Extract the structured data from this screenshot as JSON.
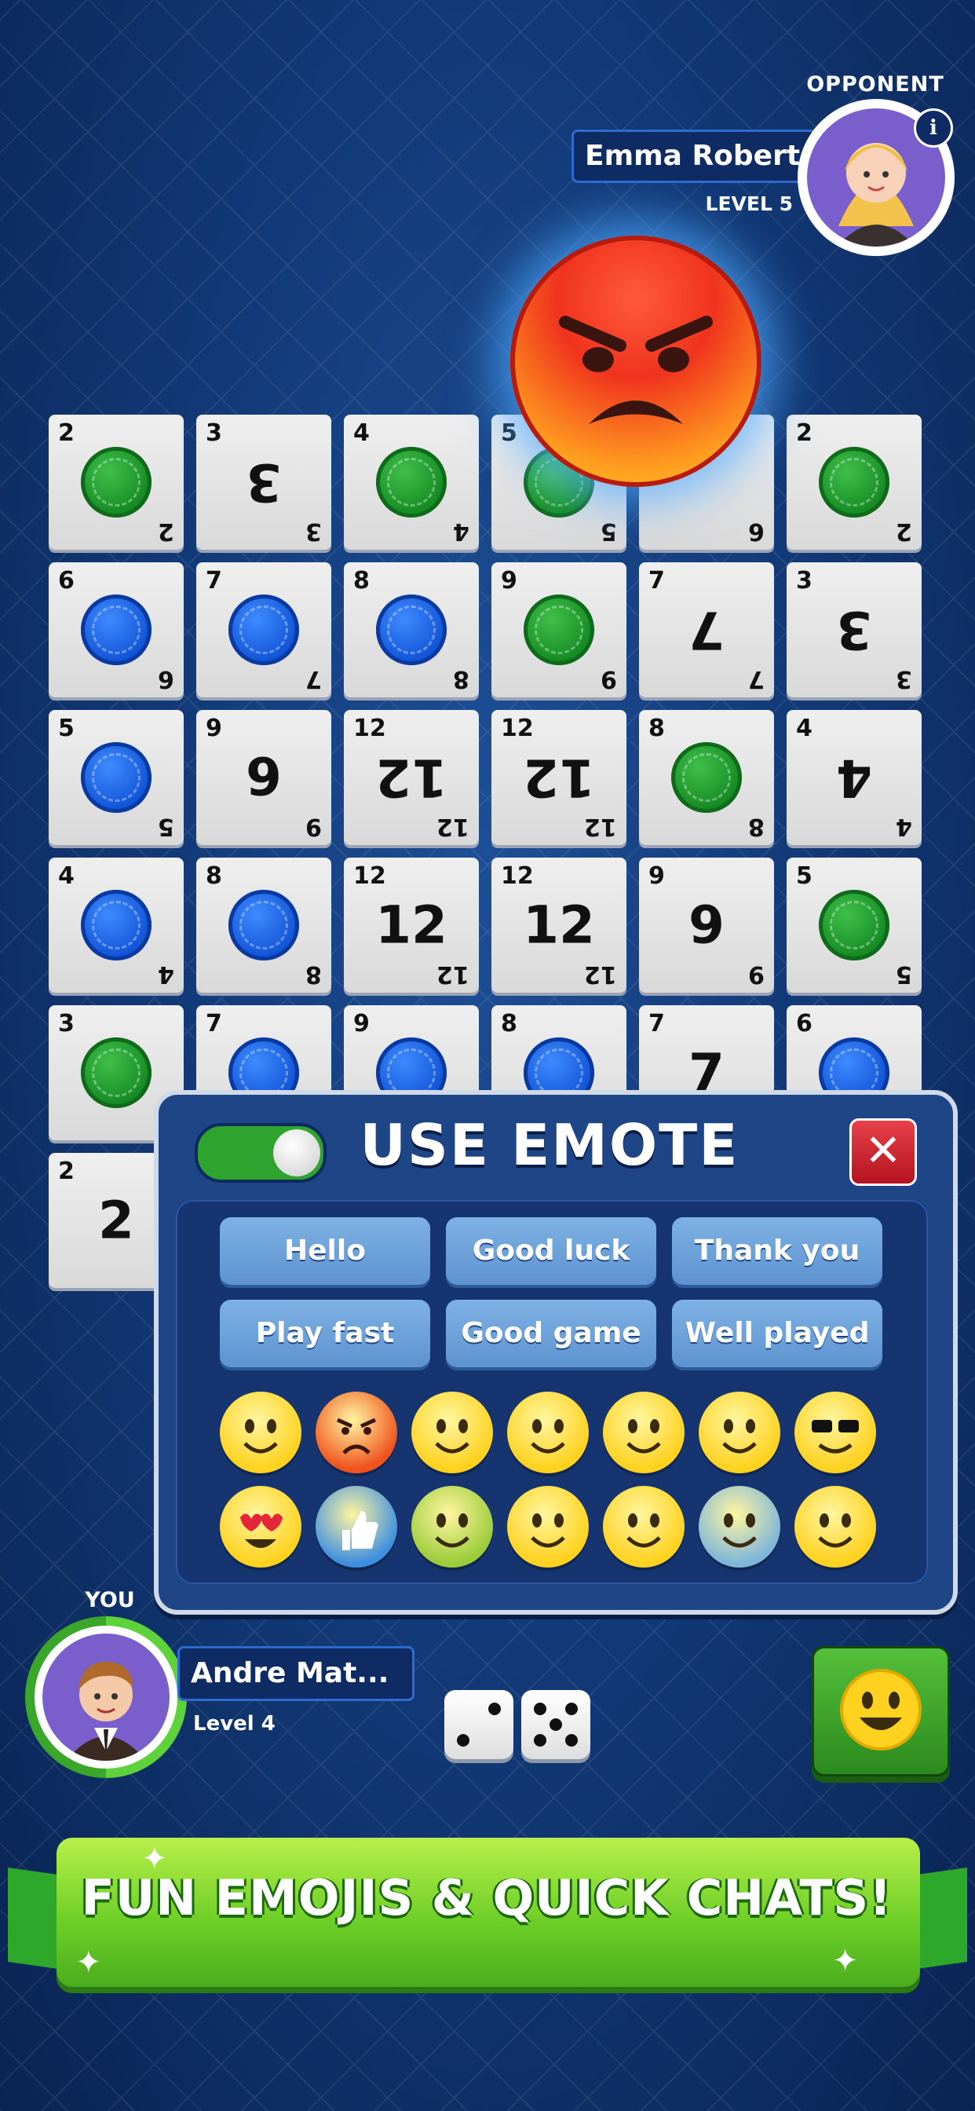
{
  "opponent": {
    "label": "OPPONENT",
    "name": "Emma Roberts",
    "level": "LEVEL 5",
    "info_icon": "i"
  },
  "board": {
    "cards": [
      {
        "n": "2",
        "chip": "green"
      },
      {
        "n": "3",
        "center": "3",
        "flip": true
      },
      {
        "n": "4",
        "chip": "green"
      },
      {
        "n": "5",
        "chip": "green"
      },
      {
        "n": "6",
        "center": "",
        "flip": true
      },
      {
        "n": "2",
        "chip": "green"
      },
      {
        "n": "6",
        "chip": "blue"
      },
      {
        "n": "7",
        "chip": "blue"
      },
      {
        "n": "8",
        "chip": "blue"
      },
      {
        "n": "9",
        "chip": "green"
      },
      {
        "n": "7",
        "center": "7",
        "flip": true
      },
      {
        "n": "3",
        "center": "3",
        "flip": true
      },
      {
        "n": "5",
        "chip": "blue"
      },
      {
        "n": "9",
        "center": "9",
        "flip": false
      },
      {
        "n": "12",
        "center": "12",
        "flip": true
      },
      {
        "n": "12",
        "center": "12",
        "flip": true
      },
      {
        "n": "8",
        "chip": "green"
      },
      {
        "n": "4",
        "center": "4",
        "flip": true
      },
      {
        "n": "4",
        "chip": "blue"
      },
      {
        "n": "8",
        "chip": "blue"
      },
      {
        "n": "12",
        "center": "12",
        "flip": false
      },
      {
        "n": "12",
        "center": "12",
        "flip": false
      },
      {
        "n": "9",
        "center": "9",
        "flip": false
      },
      {
        "n": "5",
        "chip": "green"
      },
      {
        "n": "3",
        "chip": "green"
      },
      {
        "n": "7",
        "chip": "blue"
      },
      {
        "n": "9",
        "chip": "blue"
      },
      {
        "n": "8",
        "chip": "blue"
      },
      {
        "n": "7",
        "center": "7",
        "flip": false
      },
      {
        "n": "6",
        "chip": "blue"
      },
      {
        "n": "2",
        "center": "2",
        "flip": false
      }
    ]
  },
  "emote_panel": {
    "title": "USE EMOTE",
    "toggle_on": true,
    "close_icon": "✕",
    "quick_chats": [
      "Hello",
      "Good luck",
      "Thank you",
      "Play fast",
      "Good game",
      "Well played"
    ],
    "emojis": [
      "pleading-face",
      "angry-face",
      "smiling-face",
      "crying-face",
      "laughing-face",
      "thinking-face",
      "sunglasses-face",
      "heart-eyes-face",
      "thumbs-up",
      "nauseated-face",
      "kissing-face",
      "money-mouth-face",
      "anxious-sweat-face",
      "woozy-face"
    ]
  },
  "player": {
    "label": "YOU",
    "name": "Andre Mat...",
    "level": "Level 4",
    "dice": [
      2,
      5
    ]
  },
  "banner": {
    "text": "FUN EMOJIS & QUICK CHATS!"
  },
  "colors": {
    "background": "#123a78",
    "chip_green": "#148a22",
    "chip_blue": "#1053d6",
    "panel": "#1e4585",
    "banner": "#6fcf27"
  }
}
